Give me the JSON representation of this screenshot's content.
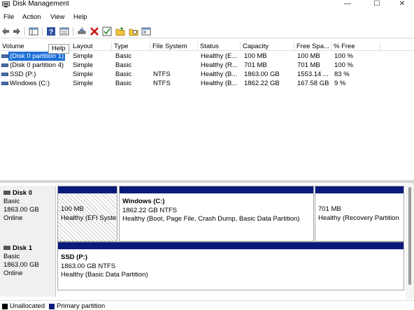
{
  "window": {
    "title": "Disk Management",
    "controls": [
      "—",
      "☐",
      "✕"
    ]
  },
  "menu": [
    "File",
    "Action",
    "View",
    "Help"
  ],
  "tooltip": "Help",
  "columns": [
    "Volume",
    "Layout",
    "Type",
    "File System",
    "Status",
    "Capacity",
    "Free Spa...",
    "% Free"
  ],
  "volumes": [
    {
      "volume": "(Disk 0 partition 1)",
      "layout": "Simple",
      "type": "Basic",
      "fs": "",
      "status": "Healthy (E...",
      "capacity": "100 MB",
      "free": "100 MB",
      "pct": "100 %"
    },
    {
      "volume": "(Disk 0 partition 4)",
      "layout": "Simple",
      "type": "Basic",
      "fs": "",
      "status": "Healthy (R...",
      "capacity": "701 MB",
      "free": "701 MB",
      "pct": "100 %"
    },
    {
      "volume": "SSD (P:)",
      "layout": "Simple",
      "type": "Basic",
      "fs": "NTFS",
      "status": "Healthy (B...",
      "capacity": "1863.00 GB",
      "free": "1553.14 ...",
      "pct": "83 %"
    },
    {
      "volume": "Windows (C:)",
      "layout": "Simple",
      "type": "Basic",
      "fs": "NTFS",
      "status": "Healthy (B...",
      "capacity": "1862.22 GB",
      "free": "167.58 GB",
      "pct": "9 %"
    }
  ],
  "disks": [
    {
      "name": "Disk 0",
      "type": "Basic",
      "size": "1863.00 GB",
      "state": "Online",
      "partitions": [
        {
          "name": "",
          "size": "100 MB",
          "status": "Healthy (EFI System"
        },
        {
          "name": "Windows  (C:)",
          "size": "1862.22 GB NTFS",
          "status": "Healthy (Boot, Page File, Crash Dump, Basic Data Partition)"
        },
        {
          "name": "",
          "size": "701 MB",
          "status": "Healthy (Recovery Partition"
        }
      ]
    },
    {
      "name": "Disk 1",
      "type": "Basic",
      "size": "1863.00 GB",
      "state": "Online",
      "partitions": [
        {
          "name": "SSD  (P:)",
          "size": "1863.00 GB NTFS",
          "status": "Healthy (Basic Data Partition)"
        }
      ]
    }
  ],
  "legend": [
    {
      "label": "Unallocated",
      "color": "#000000"
    },
    {
      "label": "Primary partition",
      "color": "#0a1a7a"
    }
  ],
  "icons": [
    "back-icon",
    "forward-icon",
    "console-tree-icon",
    "help-icon",
    "properties-icon",
    "connect-icon",
    "delete-icon",
    "check-icon",
    "new-folder-icon",
    "open-icon",
    "refresh-icon"
  ]
}
